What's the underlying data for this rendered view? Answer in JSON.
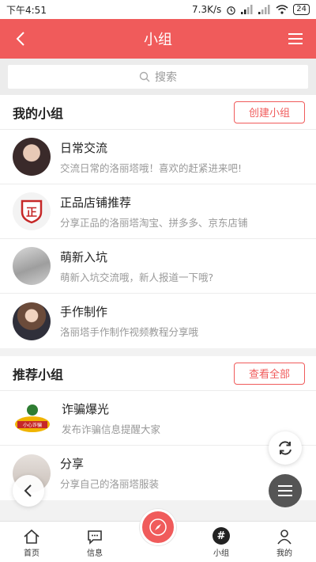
{
  "status_bar": {
    "time": "下午4:51",
    "network_speed": "7.3K/s",
    "battery": "24"
  },
  "nav": {
    "title": "小组"
  },
  "search": {
    "placeholder": "搜索"
  },
  "my_groups": {
    "title": "我的小组",
    "action_label": "创建小组",
    "items": [
      {
        "name": "日常交流",
        "desc": "交流日常的洛丽塔哦！喜欢的赶紧进来吧!"
      },
      {
        "name": "正品店铺推荐",
        "desc": "分享正品的洛丽塔淘宝、拼多多、京东店铺",
        "badge": "正"
      },
      {
        "name": "萌新入坑",
        "desc": "萌新入坑交流哦，新人报道一下哦?"
      },
      {
        "name": "手作制作",
        "desc": "洛丽塔手作制作视频教程分享哦"
      }
    ]
  },
  "recommended": {
    "title": "推荐小组",
    "action_label": "查看全部",
    "items": [
      {
        "name": "诈骗爆光",
        "desc": "发布诈骗信息提醒大家",
        "badge": "小心诈骗"
      },
      {
        "name": "分享",
        "desc": "分享自己的洛丽塔服装"
      }
    ]
  },
  "tabs": [
    {
      "label": "首页",
      "icon": "home-icon"
    },
    {
      "label": "信息",
      "icon": "message-icon"
    },
    {
      "label": "",
      "icon": "compass-icon"
    },
    {
      "label": "小组",
      "icon": "hashtag-icon"
    },
    {
      "label": "我的",
      "icon": "user-icon"
    }
  ],
  "colors": {
    "accent": "#f05b5b",
    "text_primary": "#222222",
    "text_secondary": "#999999"
  }
}
